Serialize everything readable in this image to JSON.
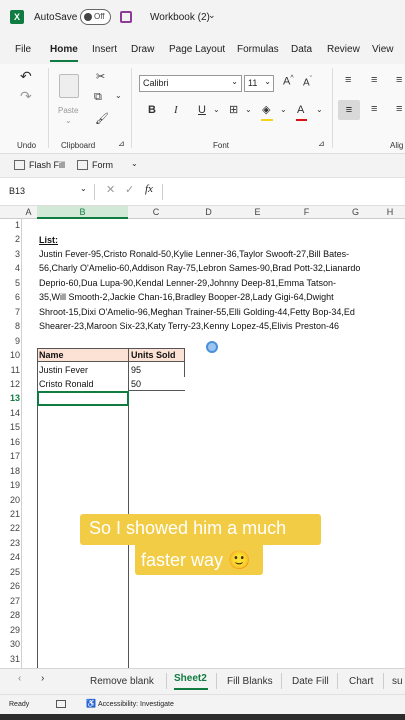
{
  "titlebar": {
    "autosave_label": "AutoSave",
    "autosave_state": "Off",
    "workbook_title": "Workbook (2)"
  },
  "menu": [
    "File",
    "Home",
    "Insert",
    "Draw",
    "Page Layout",
    "Formulas",
    "Data",
    "Review",
    "View"
  ],
  "ribbon": {
    "font_name": "Calibri",
    "font_size": "11",
    "paste_label": "Paste",
    "groups": {
      "undo": "Undo",
      "clipboard": "Clipboard",
      "font": "Font",
      "alignment": "Alig"
    },
    "bold": "B",
    "italic": "I",
    "underline": "U"
  },
  "tools": {
    "flash_fill": "Flash Fill",
    "form": "Form"
  },
  "formula_bar": {
    "name_box": "B13",
    "fx": "fx",
    "formula": ""
  },
  "columns": [
    "A",
    "B",
    "C",
    "D",
    "E",
    "F",
    "G",
    "H"
  ],
  "rows": [
    "1",
    "2",
    "3",
    "4",
    "5",
    "6",
    "7",
    "8",
    "9",
    "10",
    "11",
    "12",
    "13",
    "14",
    "15",
    "16",
    "17",
    "18",
    "19",
    "20",
    "21",
    "22",
    "23",
    "24",
    "25",
    "26",
    "27",
    "28",
    "29",
    "30",
    "31"
  ],
  "sheet": {
    "list_title": "List:",
    "list_lines": [
      "Justin Fever-95,Cristo Ronald-50,Kylie Lenner-36,Taylor Swooft-27,Bill Bates-",
      "56,Charly O'Amelio-60,Addison Ray-75,Lebron Sames-90,Brad Pott-32,Lianardo",
      "Deprio-60,Dua Lupa-90,Kendal Lenner-29,Johnny Deep-81,Emma Tatson-",
      "35,Will Smooth-2,Jackie Chan-16,Bradley Booper-28,Lady Gigi-64,Dwight",
      "Shroot-15,Dixi O'Amelio-96,Meghan Trainer-55,Elli Golding-44,Fetty Bop-34,Ed",
      "Shearer-23,Maroon Six-23,Katy Terry-23,Kenny Lopez-45,Elivis Preston-46"
    ],
    "table": {
      "headers": [
        "Name",
        "Units Sold"
      ],
      "rows": [
        [
          "Justin Fever",
          "95"
        ],
        [
          "Cristo Ronald",
          "50"
        ]
      ]
    }
  },
  "caption": {
    "line1": "So I showed him a much",
    "line2": "faster way 🙂"
  },
  "tabs": [
    "Remove blank",
    "Sheet2",
    "Fill Blanks",
    "Date Fill",
    "Chart",
    "su"
  ],
  "active_tab": "Sheet2",
  "status": {
    "ready": "Ready",
    "accessibility": "Accessibility: Investigate"
  },
  "colors": {
    "header_fill": "#fbe2d5",
    "accent_green": "#107c41",
    "caption_bg": "#f2cc45"
  }
}
